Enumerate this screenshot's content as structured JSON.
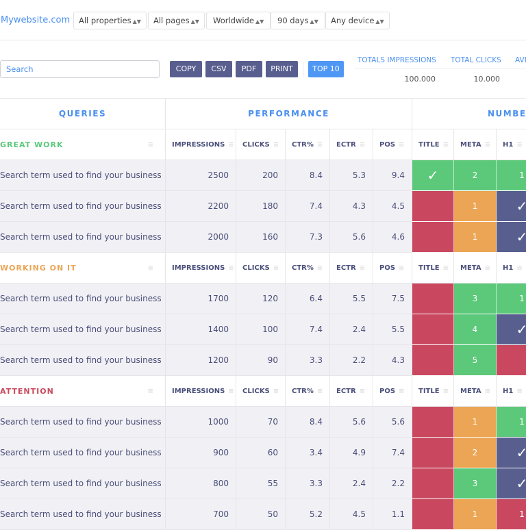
{
  "header": {
    "brand": "Mywebsite.com",
    "filters": [
      "All properties",
      "All pages",
      "Worldwide",
      "90 days",
      "Any device"
    ]
  },
  "toolbar": {
    "search_placeholder": "Search",
    "buttons": [
      "COPY",
      "CSV",
      "PDF",
      "PRINT"
    ],
    "top10": "TOP 10"
  },
  "totals": [
    {
      "label": "TOTALS IMPRESSIONS",
      "value": "100.000"
    },
    {
      "label": "TOTAL CLICKS",
      "value": "10.000"
    },
    {
      "label": "AVE",
      "value": ""
    }
  ],
  "groups": [
    "QUERIES",
    "PERFORMANCE",
    "NUMBER"
  ],
  "columns": [
    "IMPRESSIONS",
    "CLICKS",
    "CTR%",
    "ECTR",
    "POS",
    "TITLE",
    "META",
    "H1"
  ],
  "colors": {
    "green": "#5cc87a",
    "red": "#c9485f",
    "orange": "#eba554",
    "navy": "#585f8f",
    "great": "#5cc87a",
    "working": "#eba554",
    "attention": "#c9485f"
  },
  "sections": [
    {
      "title": "GREAT WORK",
      "color": "great",
      "rows": [
        {
          "query": "Search term used to find your business",
          "values": [
            "2500",
            "200",
            "8.4",
            "5.3",
            "9.4"
          ],
          "checks": [
            [
              "green",
              "✓"
            ],
            [
              "green",
              "2"
            ],
            [
              "green",
              "1"
            ]
          ]
        },
        {
          "query": "Search term used to find your business",
          "values": [
            "2200",
            "180",
            "7.4",
            "4.3",
            "4.5"
          ],
          "checks": [
            [
              "red",
              ""
            ],
            [
              "orange",
              "1"
            ],
            [
              "navy",
              "✓"
            ]
          ]
        },
        {
          "query": "Search term used to find your business",
          "values": [
            "2000",
            "160",
            "7.3",
            "5.6",
            "4.6"
          ],
          "checks": [
            [
              "red",
              ""
            ],
            [
              "orange",
              "1"
            ],
            [
              "navy",
              "✓"
            ]
          ]
        }
      ]
    },
    {
      "title": "WORKING ON IT",
      "color": "working",
      "rows": [
        {
          "query": "Search term used to find your business",
          "values": [
            "1700",
            "120",
            "6.4",
            "5.5",
            "7.5"
          ],
          "checks": [
            [
              "red",
              ""
            ],
            [
              "green",
              "3"
            ],
            [
              "green",
              "1"
            ]
          ]
        },
        {
          "query": "Search term used to find your business",
          "values": [
            "1400",
            "100",
            "7.4",
            "2.4",
            "5.5"
          ],
          "checks": [
            [
              "red",
              ""
            ],
            [
              "green",
              "4"
            ],
            [
              "navy",
              "✓"
            ]
          ]
        },
        {
          "query": "Search term used to find your business",
          "values": [
            "1200",
            "90",
            "3.3",
            "2.2",
            "4.3"
          ],
          "checks": [
            [
              "red",
              ""
            ],
            [
              "green",
              "5"
            ],
            [
              "red",
              ""
            ]
          ]
        }
      ]
    },
    {
      "title": "ATTENTION",
      "color": "attention",
      "rows": [
        {
          "query": "Search term used to find your business",
          "values": [
            "1000",
            "70",
            "8.4",
            "5.6",
            "5.6"
          ],
          "checks": [
            [
              "red",
              ""
            ],
            [
              "orange",
              "1"
            ],
            [
              "green",
              "1"
            ]
          ]
        },
        {
          "query": "Search term used to find your business",
          "values": [
            "900",
            "60",
            "3.4",
            "4.9",
            "7.4"
          ],
          "checks": [
            [
              "red",
              ""
            ],
            [
              "orange",
              "2"
            ],
            [
              "navy",
              "✓"
            ]
          ]
        },
        {
          "query": "Search term used to find your business",
          "values": [
            "800",
            "55",
            "3.3",
            "2.4",
            "2.2"
          ],
          "checks": [
            [
              "red",
              ""
            ],
            [
              "green",
              "3"
            ],
            [
              "navy",
              "✓"
            ]
          ]
        },
        {
          "query": "Search term used to find your business",
          "values": [
            "700",
            "50",
            "5.2",
            "4.5",
            "1.1"
          ],
          "checks": [
            [
              "red",
              ""
            ],
            [
              "orange",
              "1"
            ],
            [
              "red",
              "1"
            ]
          ]
        }
      ]
    }
  ]
}
